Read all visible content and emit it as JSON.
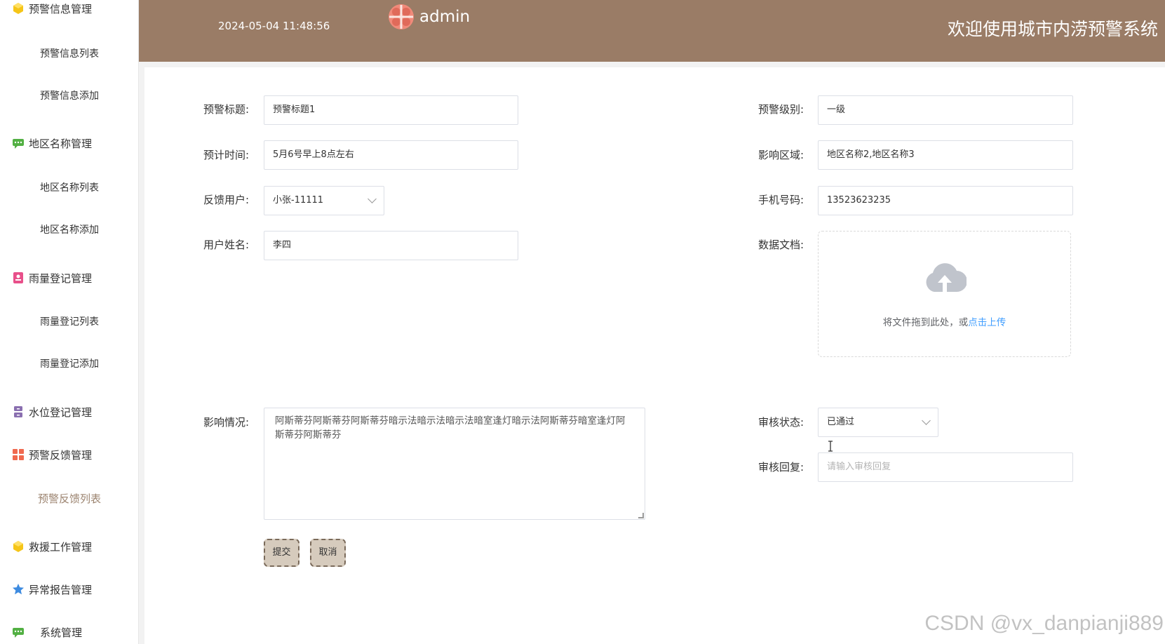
{
  "sidebar": {
    "groups": [
      {
        "label": "预警信息管理",
        "icon": "cube-icon",
        "items": [
          "预警信息列表",
          "预警信息添加"
        ]
      },
      {
        "label": "地区名称管理",
        "icon": "chat-icon",
        "items": [
          "地区名称列表",
          "地区名称添加"
        ]
      },
      {
        "label": "雨量登记管理",
        "icon": "id-card-icon",
        "items": [
          "雨量登记列表",
          "雨量登记添加"
        ]
      },
      {
        "label": "水位登记管理",
        "icon": "drawer-icon",
        "items": []
      },
      {
        "label": "预警反馈管理",
        "icon": "grid-icon",
        "items": [
          "预警反馈列表"
        ]
      },
      {
        "label": "救援工作管理",
        "icon": "cube-icon",
        "items": []
      },
      {
        "label": "异常报告管理",
        "icon": "star-icon",
        "items": []
      },
      {
        "label": "系统管理",
        "icon": "chat-icon",
        "items": []
      }
    ],
    "active_item": "预警反馈列表"
  },
  "header": {
    "datetime": "2024-05-04 11:48:56",
    "username": "admin",
    "welcome": "欢迎使用城市内涝预警系统"
  },
  "form": {
    "warning_title": {
      "label": "预警标题:",
      "value": "预警标题1"
    },
    "warning_level": {
      "label": "预警级别:",
      "value": "一级"
    },
    "estimated_time": {
      "label": "预计时间:",
      "value": "5月6号早上8点左右"
    },
    "affected_area": {
      "label": "影响区域:",
      "value": "地区名称2,地区名称3"
    },
    "feedback_user": {
      "label": "反馈用户:",
      "value": "小张-11111"
    },
    "phone": {
      "label": "手机号码:",
      "value": "13523623235"
    },
    "user_name": {
      "label": "用户姓名:",
      "value": "李四"
    },
    "data_doc": {
      "label": "数据文档:",
      "upload_text": "将文件拖到此处，或",
      "upload_link": "点击上传"
    },
    "impact": {
      "label": "影响情况:",
      "value": "阿斯蒂芬阿斯蒂芬阿斯蒂芬暗示法暗示法暗示法暗室逢灯暗示法阿斯蒂芬暗室逢灯阿斯蒂芬阿斯蒂芬"
    },
    "review_status": {
      "label": "审核状态:",
      "value": "已通过"
    },
    "review_reply": {
      "label": "审核回复:",
      "placeholder": "请输入审核回复"
    },
    "submit_label": "提交",
    "cancel_label": "取消"
  },
  "watermark": "CSDN @vx_danpianji889",
  "colors": {
    "header_bg": "#9a7c66",
    "accent": "#9c8470",
    "link": "#409eff",
    "button_bg": "#d6cbbd"
  }
}
